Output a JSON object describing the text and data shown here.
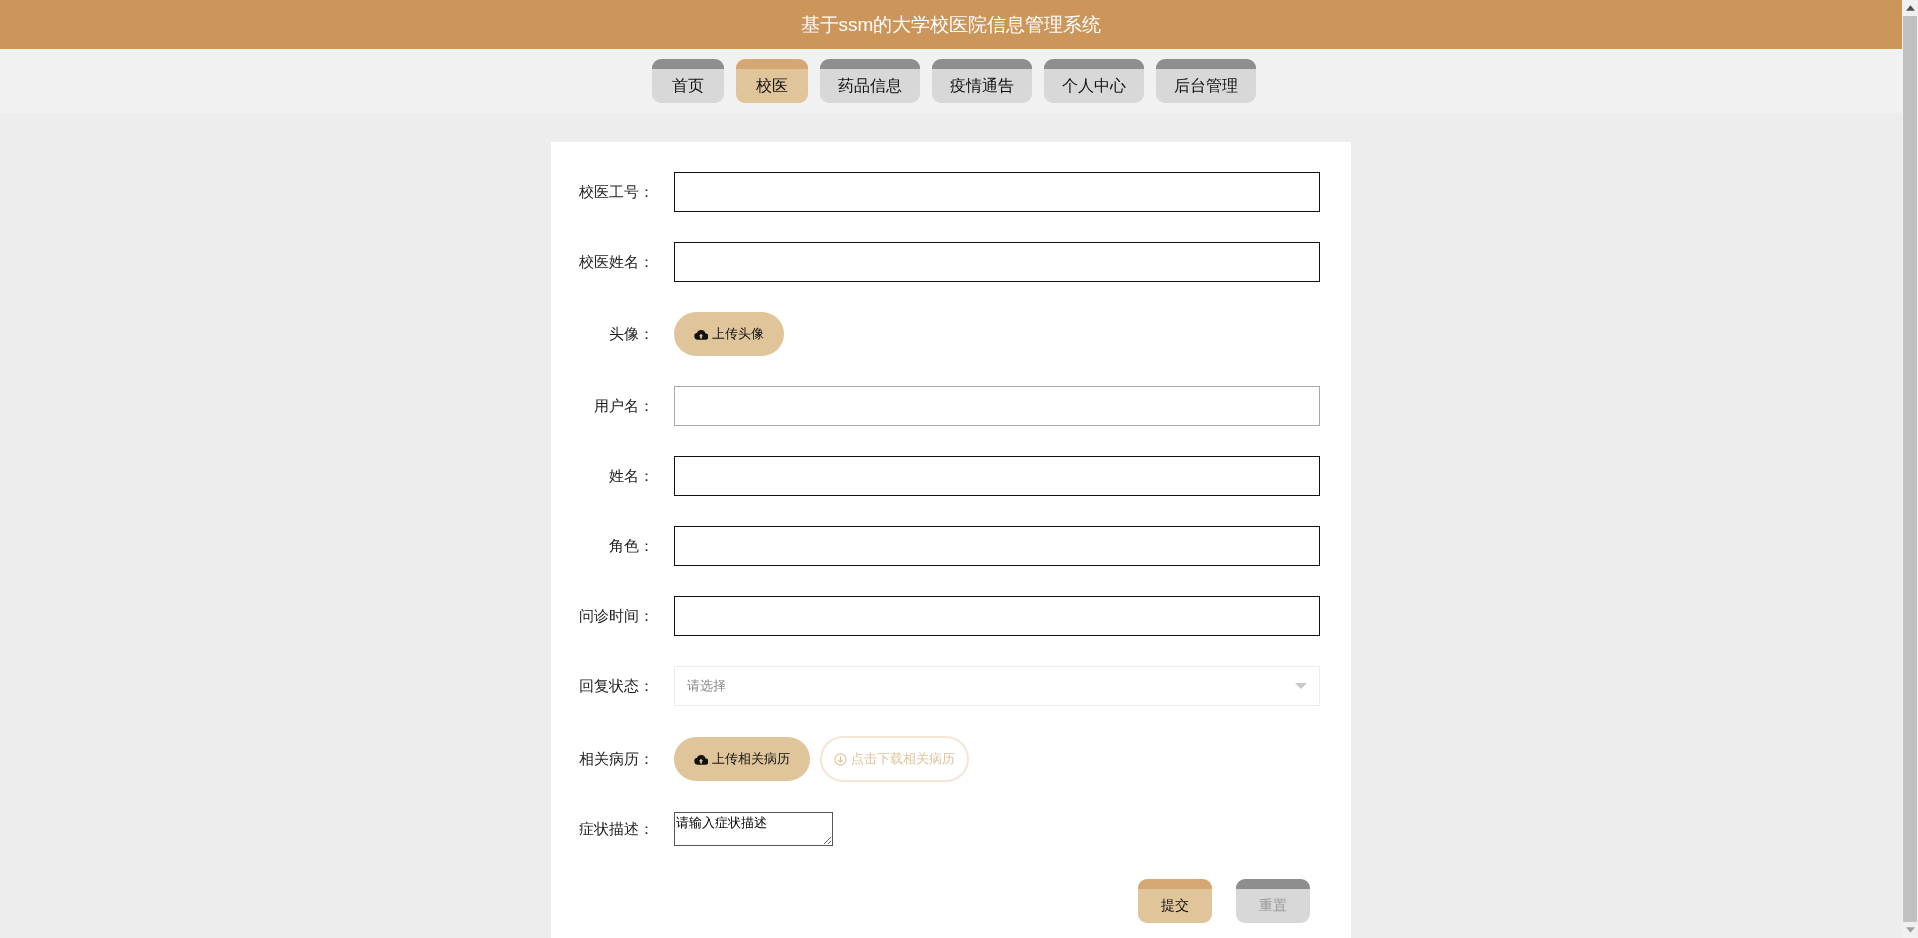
{
  "header": {
    "title": "基于ssm的大学校医院信息管理系统"
  },
  "nav": [
    {
      "label": "首页",
      "selected": false
    },
    {
      "label": "校医",
      "selected": true
    },
    {
      "label": "药品信息",
      "selected": false
    },
    {
      "label": "疫情通告",
      "selected": false
    },
    {
      "label": "个人中心",
      "selected": false
    },
    {
      "label": "后台管理",
      "selected": false
    }
  ],
  "form": {
    "fields": [
      {
        "kind": "text",
        "label": "校医工号：",
        "readonly": false
      },
      {
        "kind": "text",
        "label": "校医姓名：",
        "readonly": false
      },
      {
        "kind": "upload",
        "label": "头像：",
        "button": "上传头像"
      },
      {
        "kind": "text",
        "label": "用户名：",
        "readonly": true
      },
      {
        "kind": "text",
        "label": "姓名：",
        "readonly": false
      },
      {
        "kind": "text",
        "label": "角色：",
        "readonly": false
      },
      {
        "kind": "text",
        "label": "问诊时间：",
        "readonly": false
      },
      {
        "kind": "select",
        "label": "回复状态：",
        "placeholder": "请选择"
      },
      {
        "kind": "files",
        "label": "相关病历：",
        "button": "上传相关病历",
        "link": "点击下载相关病历"
      },
      {
        "kind": "textarea",
        "label": "症状描述：",
        "value": "请输入症状描述"
      }
    ],
    "buttons": [
      {
        "kind": "primary",
        "label": "提交"
      },
      {
        "kind": "secondary",
        "label": "重置"
      }
    ]
  }
}
